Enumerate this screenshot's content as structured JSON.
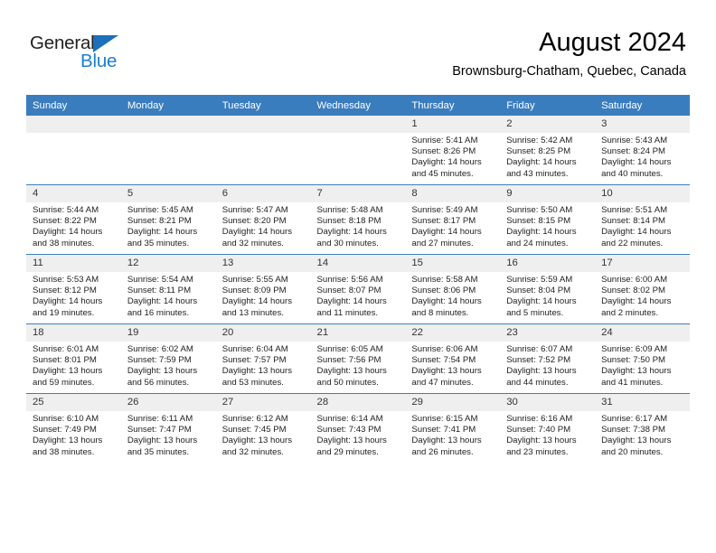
{
  "brand": {
    "name_top": "General",
    "name_bottom": "Blue",
    "triangle_color": "#1c6fba",
    "blue_color": "#1c7fd0"
  },
  "header": {
    "month_title": "August 2024",
    "location": "Brownsburg-Chatham, Quebec, Canada"
  },
  "theme": {
    "header_blue": "#3a7dbf",
    "daynum_bg": "#efefef"
  },
  "weekdays": [
    "Sunday",
    "Monday",
    "Tuesday",
    "Wednesday",
    "Thursday",
    "Friday",
    "Saturday"
  ],
  "weeks": [
    [
      {
        "day": "",
        "sunrise": "",
        "sunset": "",
        "daylight1": "",
        "daylight2": "",
        "empty": true
      },
      {
        "day": "",
        "sunrise": "",
        "sunset": "",
        "daylight1": "",
        "daylight2": "",
        "empty": true
      },
      {
        "day": "",
        "sunrise": "",
        "sunset": "",
        "daylight1": "",
        "daylight2": "",
        "empty": true
      },
      {
        "day": "",
        "sunrise": "",
        "sunset": "",
        "daylight1": "",
        "daylight2": "",
        "empty": true
      },
      {
        "day": "1",
        "sunrise": "Sunrise: 5:41 AM",
        "sunset": "Sunset: 8:26 PM",
        "daylight1": "Daylight: 14 hours",
        "daylight2": "and 45 minutes."
      },
      {
        "day": "2",
        "sunrise": "Sunrise: 5:42 AM",
        "sunset": "Sunset: 8:25 PM",
        "daylight1": "Daylight: 14 hours",
        "daylight2": "and 43 minutes."
      },
      {
        "day": "3",
        "sunrise": "Sunrise: 5:43 AM",
        "sunset": "Sunset: 8:24 PM",
        "daylight1": "Daylight: 14 hours",
        "daylight2": "and 40 minutes."
      }
    ],
    [
      {
        "day": "4",
        "sunrise": "Sunrise: 5:44 AM",
        "sunset": "Sunset: 8:22 PM",
        "daylight1": "Daylight: 14 hours",
        "daylight2": "and 38 minutes."
      },
      {
        "day": "5",
        "sunrise": "Sunrise: 5:45 AM",
        "sunset": "Sunset: 8:21 PM",
        "daylight1": "Daylight: 14 hours",
        "daylight2": "and 35 minutes."
      },
      {
        "day": "6",
        "sunrise": "Sunrise: 5:47 AM",
        "sunset": "Sunset: 8:20 PM",
        "daylight1": "Daylight: 14 hours",
        "daylight2": "and 32 minutes."
      },
      {
        "day": "7",
        "sunrise": "Sunrise: 5:48 AM",
        "sunset": "Sunset: 8:18 PM",
        "daylight1": "Daylight: 14 hours",
        "daylight2": "and 30 minutes."
      },
      {
        "day": "8",
        "sunrise": "Sunrise: 5:49 AM",
        "sunset": "Sunset: 8:17 PM",
        "daylight1": "Daylight: 14 hours",
        "daylight2": "and 27 minutes."
      },
      {
        "day": "9",
        "sunrise": "Sunrise: 5:50 AM",
        "sunset": "Sunset: 8:15 PM",
        "daylight1": "Daylight: 14 hours",
        "daylight2": "and 24 minutes."
      },
      {
        "day": "10",
        "sunrise": "Sunrise: 5:51 AM",
        "sunset": "Sunset: 8:14 PM",
        "daylight1": "Daylight: 14 hours",
        "daylight2": "and 22 minutes."
      }
    ],
    [
      {
        "day": "11",
        "sunrise": "Sunrise: 5:53 AM",
        "sunset": "Sunset: 8:12 PM",
        "daylight1": "Daylight: 14 hours",
        "daylight2": "and 19 minutes."
      },
      {
        "day": "12",
        "sunrise": "Sunrise: 5:54 AM",
        "sunset": "Sunset: 8:11 PM",
        "daylight1": "Daylight: 14 hours",
        "daylight2": "and 16 minutes."
      },
      {
        "day": "13",
        "sunrise": "Sunrise: 5:55 AM",
        "sunset": "Sunset: 8:09 PM",
        "daylight1": "Daylight: 14 hours",
        "daylight2": "and 13 minutes."
      },
      {
        "day": "14",
        "sunrise": "Sunrise: 5:56 AM",
        "sunset": "Sunset: 8:07 PM",
        "daylight1": "Daylight: 14 hours",
        "daylight2": "and 11 minutes."
      },
      {
        "day": "15",
        "sunrise": "Sunrise: 5:58 AM",
        "sunset": "Sunset: 8:06 PM",
        "daylight1": "Daylight: 14 hours",
        "daylight2": "and 8 minutes."
      },
      {
        "day": "16",
        "sunrise": "Sunrise: 5:59 AM",
        "sunset": "Sunset: 8:04 PM",
        "daylight1": "Daylight: 14 hours",
        "daylight2": "and 5 minutes."
      },
      {
        "day": "17",
        "sunrise": "Sunrise: 6:00 AM",
        "sunset": "Sunset: 8:02 PM",
        "daylight1": "Daylight: 14 hours",
        "daylight2": "and 2 minutes."
      }
    ],
    [
      {
        "day": "18",
        "sunrise": "Sunrise: 6:01 AM",
        "sunset": "Sunset: 8:01 PM",
        "daylight1": "Daylight: 13 hours",
        "daylight2": "and 59 minutes."
      },
      {
        "day": "19",
        "sunrise": "Sunrise: 6:02 AM",
        "sunset": "Sunset: 7:59 PM",
        "daylight1": "Daylight: 13 hours",
        "daylight2": "and 56 minutes."
      },
      {
        "day": "20",
        "sunrise": "Sunrise: 6:04 AM",
        "sunset": "Sunset: 7:57 PM",
        "daylight1": "Daylight: 13 hours",
        "daylight2": "and 53 minutes."
      },
      {
        "day": "21",
        "sunrise": "Sunrise: 6:05 AM",
        "sunset": "Sunset: 7:56 PM",
        "daylight1": "Daylight: 13 hours",
        "daylight2": "and 50 minutes."
      },
      {
        "day": "22",
        "sunrise": "Sunrise: 6:06 AM",
        "sunset": "Sunset: 7:54 PM",
        "daylight1": "Daylight: 13 hours",
        "daylight2": "and 47 minutes."
      },
      {
        "day": "23",
        "sunrise": "Sunrise: 6:07 AM",
        "sunset": "Sunset: 7:52 PM",
        "daylight1": "Daylight: 13 hours",
        "daylight2": "and 44 minutes."
      },
      {
        "day": "24",
        "sunrise": "Sunrise: 6:09 AM",
        "sunset": "Sunset: 7:50 PM",
        "daylight1": "Daylight: 13 hours",
        "daylight2": "and 41 minutes."
      }
    ],
    [
      {
        "day": "25",
        "sunrise": "Sunrise: 6:10 AM",
        "sunset": "Sunset: 7:49 PM",
        "daylight1": "Daylight: 13 hours",
        "daylight2": "and 38 minutes."
      },
      {
        "day": "26",
        "sunrise": "Sunrise: 6:11 AM",
        "sunset": "Sunset: 7:47 PM",
        "daylight1": "Daylight: 13 hours",
        "daylight2": "and 35 minutes."
      },
      {
        "day": "27",
        "sunrise": "Sunrise: 6:12 AM",
        "sunset": "Sunset: 7:45 PM",
        "daylight1": "Daylight: 13 hours",
        "daylight2": "and 32 minutes."
      },
      {
        "day": "28",
        "sunrise": "Sunrise: 6:14 AM",
        "sunset": "Sunset: 7:43 PM",
        "daylight1": "Daylight: 13 hours",
        "daylight2": "and 29 minutes."
      },
      {
        "day": "29",
        "sunrise": "Sunrise: 6:15 AM",
        "sunset": "Sunset: 7:41 PM",
        "daylight1": "Daylight: 13 hours",
        "daylight2": "and 26 minutes."
      },
      {
        "day": "30",
        "sunrise": "Sunrise: 6:16 AM",
        "sunset": "Sunset: 7:40 PM",
        "daylight1": "Daylight: 13 hours",
        "daylight2": "and 23 minutes."
      },
      {
        "day": "31",
        "sunrise": "Sunrise: 6:17 AM",
        "sunset": "Sunset: 7:38 PM",
        "daylight1": "Daylight: 13 hours",
        "daylight2": "and 20 minutes."
      }
    ]
  ]
}
